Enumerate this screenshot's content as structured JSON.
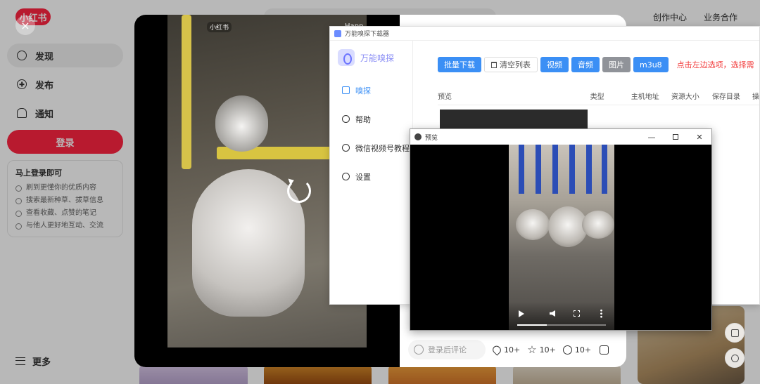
{
  "background_page": {
    "logo_text": "小红书",
    "top_links": [
      "创作中心",
      "业务合作"
    ],
    "nav": [
      {
        "label": "发现",
        "icon": "discover-icon"
      },
      {
        "label": "发布",
        "icon": "publish-icon"
      },
      {
        "label": "通知",
        "icon": "bell-icon"
      }
    ],
    "login_button": "登录",
    "login_card": {
      "title": "马上登录即可",
      "items": [
        "刷到更懂你的优质内容",
        "搜索最新种草、拔草信息",
        "查看收藏、点赞的笔记",
        "与他人更好地互动、交流"
      ]
    },
    "more_label": "更多"
  },
  "note": {
    "close_glyph": "×",
    "watermark": "小红书",
    "watermark_right": "Happ",
    "comment_placeholder": "登录后评论",
    "likes": "10+",
    "collects": "10+",
    "comments": "10+"
  },
  "downloader": {
    "window_title": "万能嗅探下载器",
    "brand_name": "万能嗅探",
    "menu": [
      {
        "label": "嗅探",
        "icon": "sniff-icon",
        "active": true
      },
      {
        "label": "帮助",
        "icon": "share-icon",
        "active": false
      },
      {
        "label": "微信视频号教程",
        "icon": "wechat-icon",
        "active": false
      },
      {
        "label": "设置",
        "icon": "gear-icon",
        "active": false
      }
    ],
    "toolbar": {
      "batch_download": "批量下载",
      "clear_list": "清空列表",
      "video": "视频",
      "audio": "音频",
      "image": "图片",
      "m3u8": "m3u8",
      "hint": "点击左边选项，选择需"
    },
    "columns": [
      "预览",
      "类型",
      "主机地址",
      "资源大小",
      "保存目录",
      "操"
    ]
  },
  "preview": {
    "window_title": "预览",
    "minimize": "—",
    "close": "✕",
    "progress": 0.33
  },
  "colors": {
    "brand_red": "#ff2442",
    "primary_blue": "#3b8ff5",
    "hint_red": "#f23c3c"
  }
}
